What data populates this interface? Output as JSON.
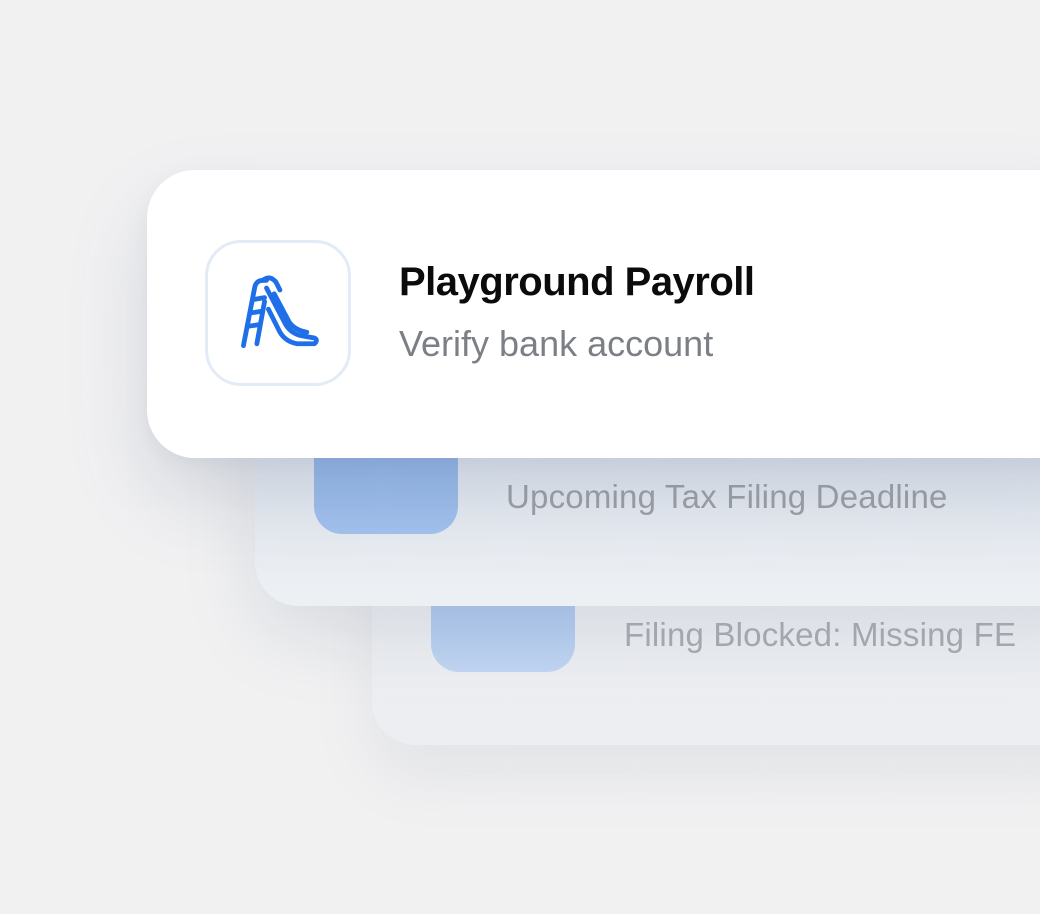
{
  "notifications": [
    {
      "title": "Playground Payroll",
      "subtitle": "Verify bank account",
      "icon": "playground-slide-icon",
      "accent": "#1f6fe8"
    },
    {
      "subtitle": "Upcoming Tax Filing Deadline"
    },
    {
      "subtitle": "Filing Blocked: Missing FE"
    }
  ]
}
